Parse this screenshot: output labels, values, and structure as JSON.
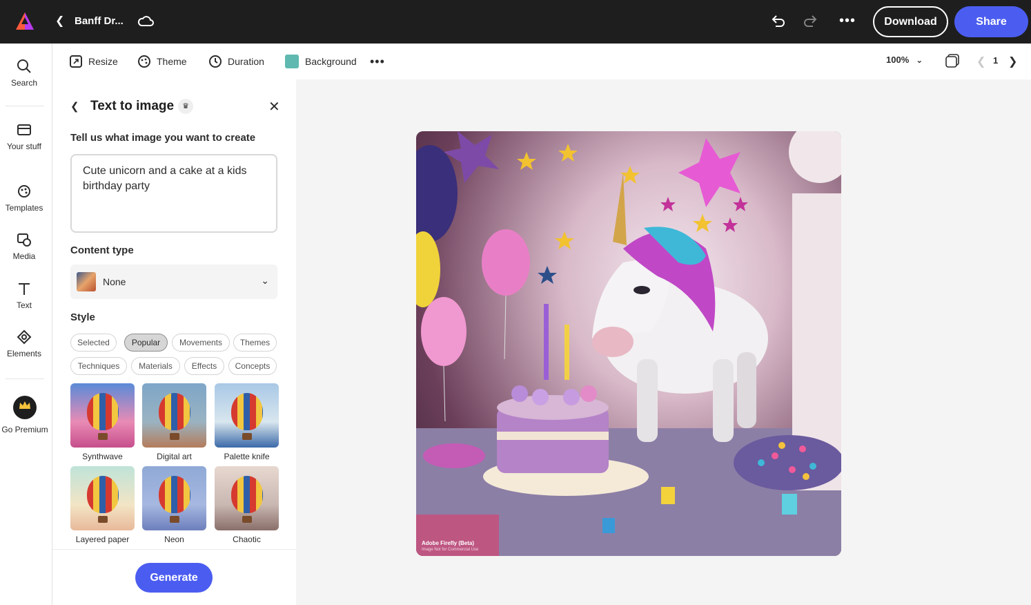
{
  "topbar": {
    "doc_title": "Banff Dr...",
    "download_label": "Download",
    "share_label": "Share",
    "accent": "#4b5df0"
  },
  "rail": {
    "items": [
      {
        "label": "Search",
        "icon": "search-icon"
      },
      {
        "label": "Your stuff",
        "icon": "folder-icon"
      },
      {
        "label": "Templates",
        "icon": "templates-icon"
      },
      {
        "label": "Media",
        "icon": "media-icon"
      },
      {
        "label": "Text",
        "icon": "text-icon"
      },
      {
        "label": "Elements",
        "icon": "elements-icon"
      },
      {
        "label": "Go Premium",
        "icon": "crown-icon"
      }
    ]
  },
  "toolbar": {
    "resize": "Resize",
    "theme": "Theme",
    "duration": "Duration",
    "background": "Background",
    "background_color": "#5fb9b0",
    "zoom": "100%",
    "page_num": "1"
  },
  "panel": {
    "title": "Text to image",
    "prompt_label": "Tell us what image you want to create",
    "prompt_value": "Cute unicorn and a cake at a kids birthday party",
    "content_type_label": "Content type",
    "content_type_value": "None",
    "style_label": "Style",
    "chips": [
      "Selected",
      "Popular",
      "Movements",
      "Themes",
      "Techniques",
      "Materials",
      "Effects",
      "Concepts"
    ],
    "active_chip": "Popular",
    "tiles": [
      "Synthwave",
      "Digital art",
      "Palette knife",
      "Layered paper",
      "Neon",
      "Chaotic"
    ],
    "generate_label": "Generate"
  },
  "canvas": {
    "watermark": "Adobe Firefly (Beta)",
    "watermark_sub": "Image Not for Commercial Use"
  }
}
